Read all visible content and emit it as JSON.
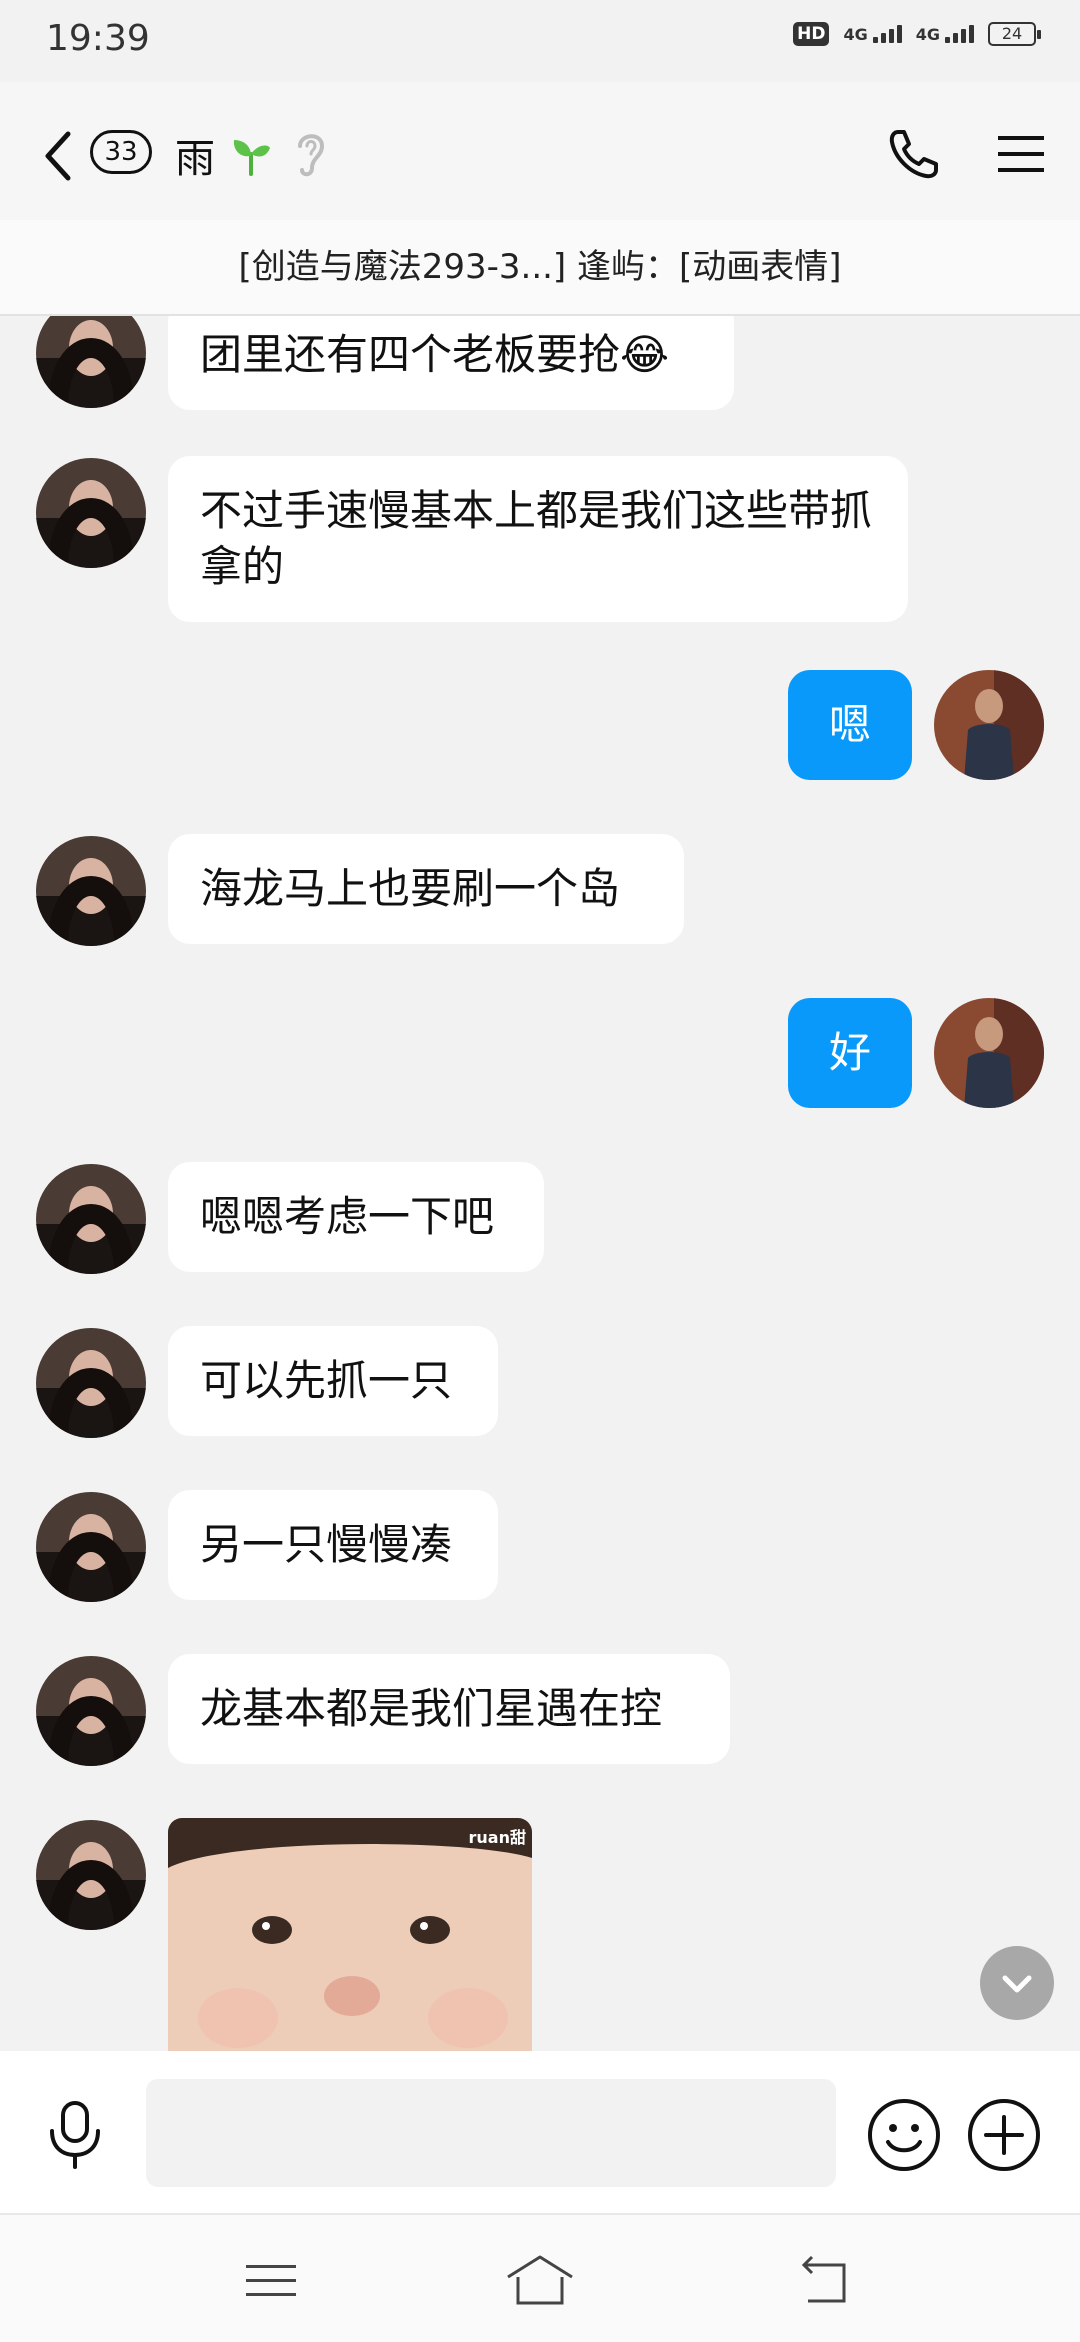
{
  "status_bar": {
    "time": "19:39",
    "hd_label": "HD",
    "network_1": "4G",
    "network_2": "4G",
    "battery": "24"
  },
  "header": {
    "unread_count": "33",
    "title": "雨"
  },
  "notice": {
    "text": "[创造与魔法293-3...] 逢屿：[动画表情]"
  },
  "messages": [
    {
      "side": "in",
      "text": "团里还有四个老板要抢😂"
    },
    {
      "side": "in",
      "text": "不过手速慢基本上都是我们这些带抓拿的"
    },
    {
      "side": "out",
      "text": "嗯"
    },
    {
      "side": "in",
      "text": "海龙马上也要刷一个岛"
    },
    {
      "side": "out",
      "text": "好"
    },
    {
      "side": "in",
      "text": "嗯嗯考虑一下吧"
    },
    {
      "side": "in",
      "text": "可以先抓一只"
    },
    {
      "side": "in",
      "text": "另一只慢慢凑"
    },
    {
      "side": "in",
      "text": "龙基本都是我们星遇在控"
    }
  ],
  "sticker": {
    "watermark": "ruan甜"
  },
  "input": {
    "value": "",
    "placeholder": ""
  },
  "colors": {
    "accent_bubble": "#0899fb",
    "background": "#f2f2f2",
    "incoming_bubble": "#ffffff"
  },
  "icons": [
    "back-icon",
    "sprout-icon",
    "ear-icon",
    "phone-icon",
    "menu-icon",
    "mic-icon",
    "emoji-icon",
    "plus-icon",
    "chevron-down-icon",
    "nav-menu-icon",
    "nav-home-icon",
    "nav-back-icon"
  ]
}
